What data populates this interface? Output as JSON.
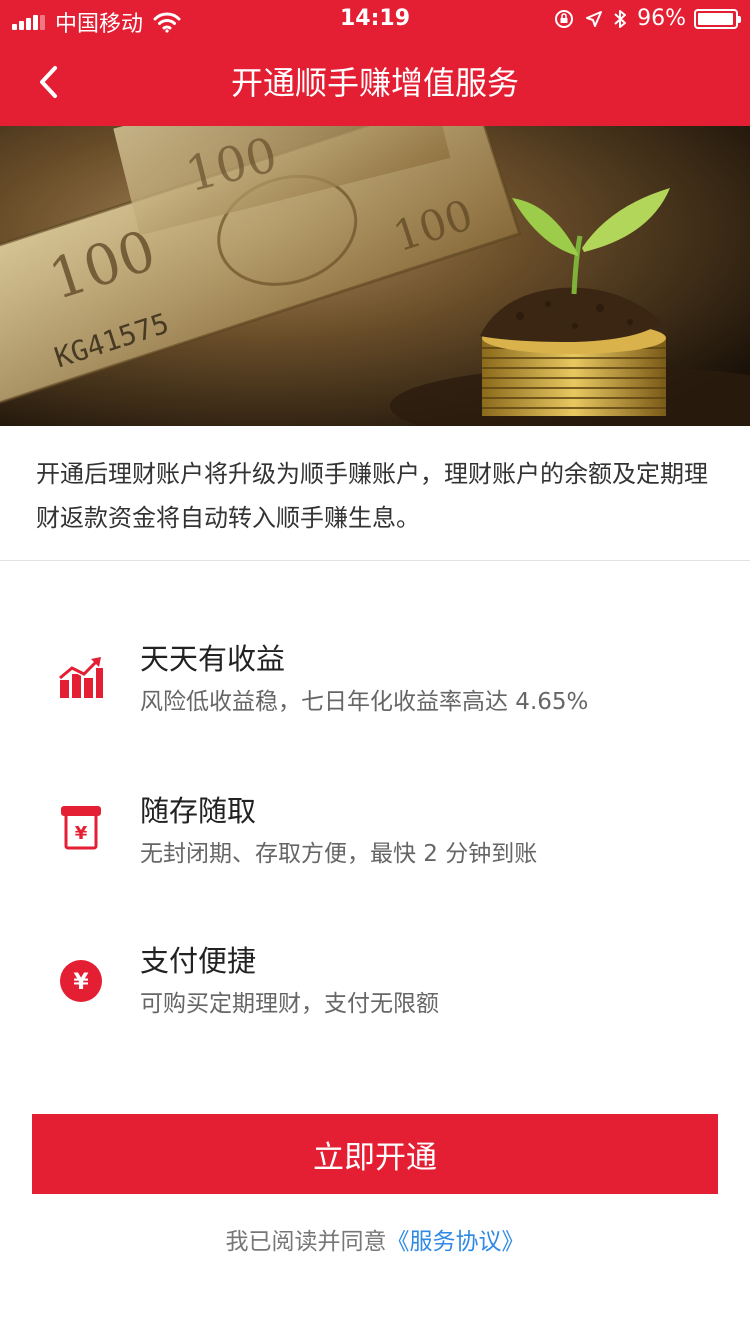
{
  "status_bar": {
    "carrier": "中国移动",
    "time": "14:19",
    "battery": "96%",
    "battery_level": 0.96
  },
  "nav": {
    "title": "开通顺手赚增值服务",
    "back_icon": "chevron-left-icon"
  },
  "banner": {
    "serial": "KG41575"
  },
  "description": "开通后理财账户将升级为顺手赚账户，理财账户的余额及定期理财返款资金将自动转入顺手赚生息。",
  "features": [
    {
      "icon": "trend-chart-icon",
      "title": "天天有收益",
      "subtitle": "风险低收益稳，七日年化收益率高达 4.65%"
    },
    {
      "icon": "yuan-box-icon",
      "title": "随存随取",
      "subtitle": "无封闭期、存取方便，最快 2 分钟到账"
    },
    {
      "icon": "yuan-circle-icon",
      "title": "支付便捷",
      "subtitle": "可购买定期理财，支付无限额"
    }
  ],
  "cta": {
    "label": "立即开通"
  },
  "agreement": {
    "prefix": "我已阅读并同意",
    "link": "《服务协议》"
  },
  "colors": {
    "brand_red": "#e41e33",
    "link_blue": "#2e8ae6"
  }
}
